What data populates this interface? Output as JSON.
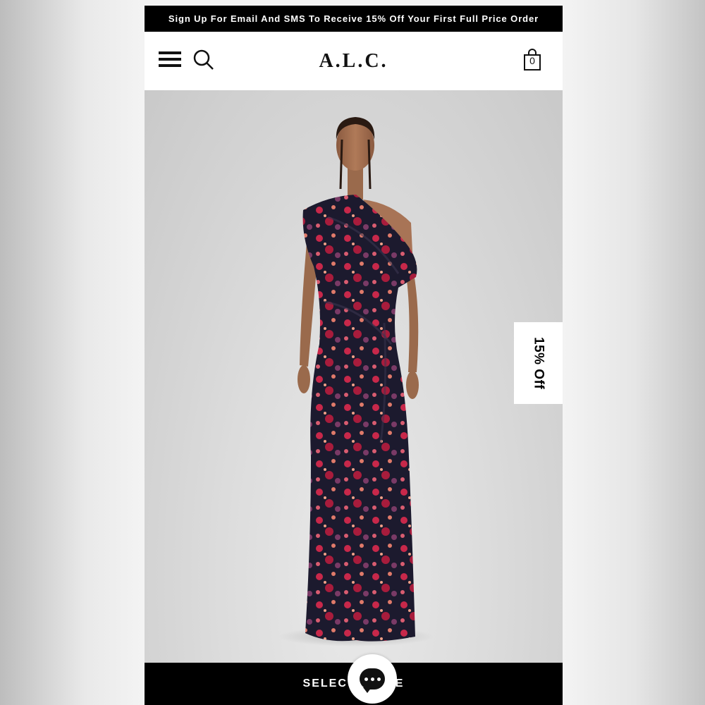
{
  "promo": {
    "text": "Sign Up For Email And SMS To Receive 15% Off Your First Full Price Order"
  },
  "header": {
    "logo": "A.L.C.",
    "bag_count": "0",
    "icons": [
      "menu-icon",
      "search-icon",
      "shopping-bag-icon"
    ]
  },
  "hero": {
    "image": "model-in-floral-one-shoulder-gown"
  },
  "side_tab": {
    "label": "15% Off"
  },
  "cta": {
    "label": "SELECT A SIZE"
  },
  "chat": {
    "icon": "chat-bubble-icon"
  },
  "colors": {
    "bar": "#000000",
    "background": "#ffffff",
    "dress_base": "#1c1a2e",
    "dress_print": "#c8284a"
  }
}
